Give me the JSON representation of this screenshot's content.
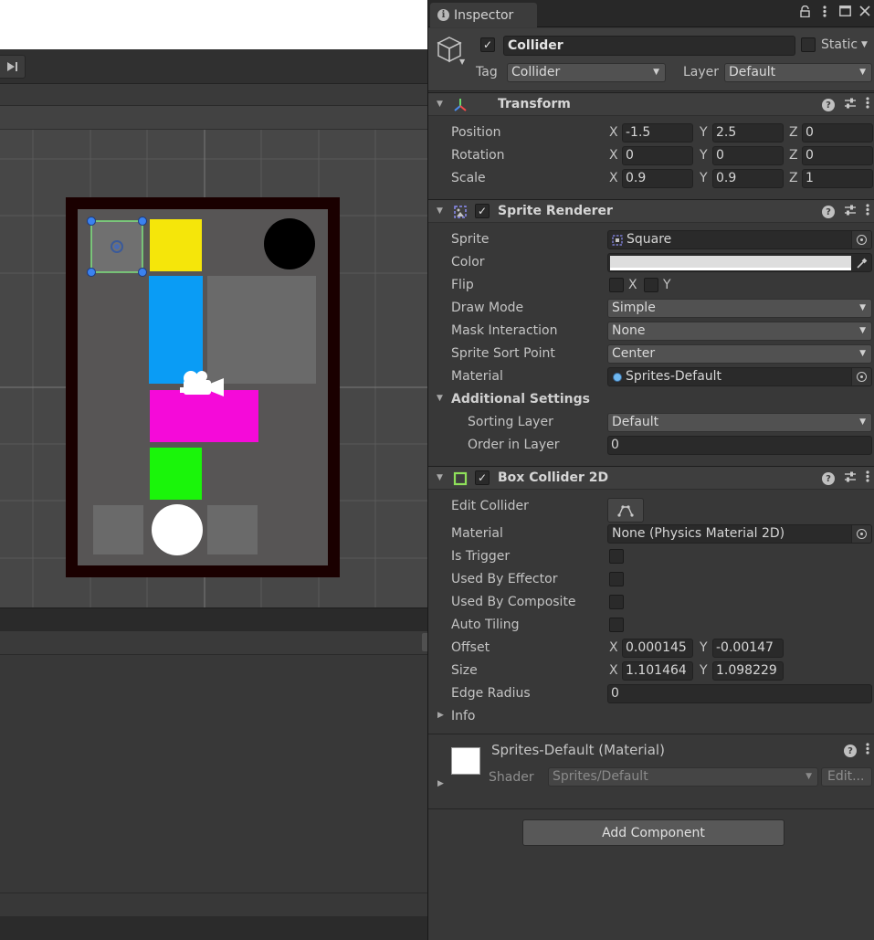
{
  "inspector": {
    "tab_label": "Inspector",
    "gameobject": {
      "name": "Collider",
      "active": true,
      "static_label": "Static",
      "tag_label": "Tag",
      "tag_value": "Collider",
      "layer_label": "Layer",
      "layer_value": "Default"
    },
    "transform": {
      "title": "Transform",
      "position_label": "Position",
      "rotation_label": "Rotation",
      "scale_label": "Scale",
      "axis_x": "X",
      "axis_y": "Y",
      "axis_z": "Z",
      "position": {
        "x": "-1.5",
        "y": "2.5",
        "z": "0"
      },
      "rotation": {
        "x": "0",
        "y": "0",
        "z": "0"
      },
      "scale": {
        "x": "0.9",
        "y": "0.9",
        "z": "1"
      }
    },
    "sprite_renderer": {
      "title": "Sprite Renderer",
      "enabled": true,
      "sprite_label": "Sprite",
      "sprite_value": "Square",
      "color_label": "Color",
      "color_value": "#dedede",
      "flip_label": "Flip",
      "flip_x": "X",
      "flip_y": "Y",
      "draw_mode_label": "Draw Mode",
      "draw_mode_value": "Simple",
      "mask_label": "Mask Interaction",
      "mask_value": "None",
      "sort_point_label": "Sprite Sort Point",
      "sort_point_value": "Center",
      "material_label": "Material",
      "material_value": "Sprites-Default",
      "additional_label": "Additional Settings",
      "sorting_layer_label": "Sorting Layer",
      "sorting_layer_value": "Default",
      "order_label": "Order in Layer",
      "order_value": "0"
    },
    "box_collider": {
      "title": "Box Collider 2D",
      "enabled": true,
      "edit_collider_label": "Edit Collider",
      "material_label": "Material",
      "material_value": "None (Physics Material 2D)",
      "is_trigger_label": "Is Trigger",
      "used_by_effector_label": "Used By Effector",
      "used_by_composite_label": "Used By Composite",
      "auto_tiling_label": "Auto Tiling",
      "offset_label": "Offset",
      "offset": {
        "x": "0.000145",
        "y": "-0.00147"
      },
      "size_label": "Size",
      "size": {
        "x": "1.101464",
        "y": "1.098229"
      },
      "edge_radius_label": "Edge Radius",
      "edge_radius_value": "0",
      "info_label": "Info"
    },
    "material_section": {
      "title": "Sprites-Default (Material)",
      "shader_label": "Shader",
      "shader_value": "Sprites/Default",
      "edit_label": "Edit..."
    },
    "add_component_label": "Add Component"
  },
  "scene": {
    "background_color": "#474747",
    "board_border_color": "#1a0000",
    "tiles": [
      {
        "name": "yellow-block",
        "color": "#f5e60a"
      },
      {
        "name": "blue-block",
        "color": "#0a9cf5"
      },
      {
        "name": "magenta-block",
        "color": "#f50ad9"
      },
      {
        "name": "green-block",
        "color": "#1af50a"
      },
      {
        "name": "black-circle",
        "color": "#000000"
      },
      {
        "name": "white-circle",
        "color": "#ffffff"
      }
    ]
  }
}
